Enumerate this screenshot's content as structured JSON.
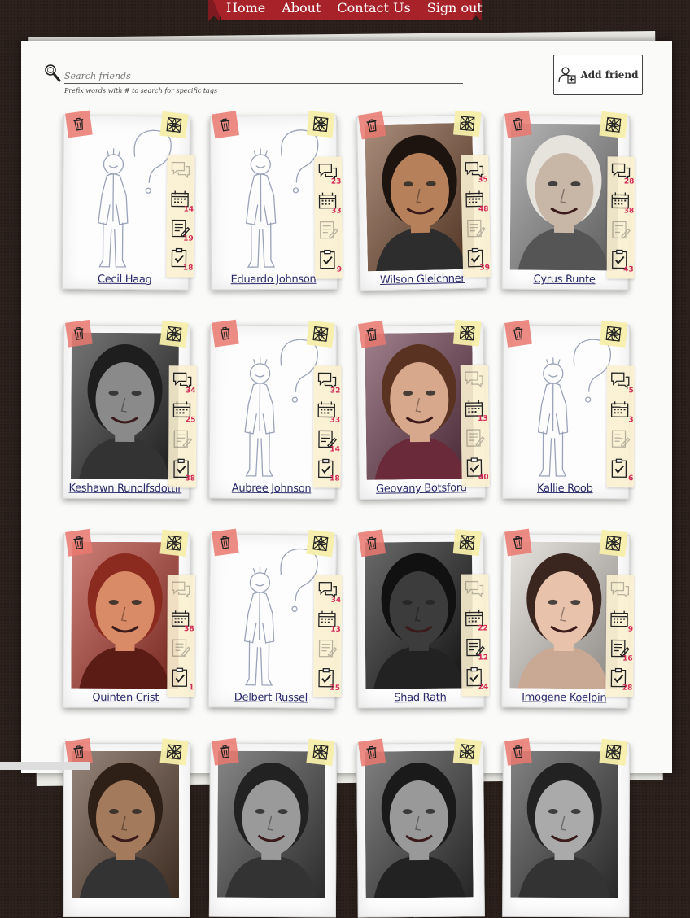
{
  "nav": {
    "home": "Home",
    "about": "About",
    "contact": "Contact Us",
    "signout": "Sign out"
  },
  "search": {
    "placeholder": "Search friends",
    "hint": "Prefix words with # to search for specific tags"
  },
  "add_friend_label": "Add friend",
  "colors": {
    "ribbon": "#a8222a",
    "count": "#d12a58",
    "name": "#2a2a6a",
    "trash": "#ea786e",
    "tag": "#f6eeaa"
  },
  "friends": [
    {
      "name": "Cecil Haag",
      "photo": "placeholder",
      "messages": "",
      "events": "14",
      "notes": "19",
      "tasks": "18"
    },
    {
      "name": "Eduardo Johnson",
      "photo": "placeholder",
      "messages": "23",
      "events": "33",
      "notes": "",
      "tasks": "9"
    },
    {
      "name": "Wilson Gleichner",
      "photo": "photo",
      "messages": "35",
      "events": "48",
      "notes": "",
      "tasks": "39"
    },
    {
      "name": "Cyrus Runte",
      "photo": "photo",
      "messages": "28",
      "events": "38",
      "notes": "",
      "tasks": "43"
    },
    {
      "name": "Keshawn Runolfsdottir",
      "photo": "photo",
      "messages": "34",
      "events": "25",
      "notes": "",
      "tasks": "38"
    },
    {
      "name": "Aubree Johnson",
      "photo": "placeholder",
      "messages": "32",
      "events": "33",
      "notes": "14",
      "tasks": "18"
    },
    {
      "name": "Geovany Botsford",
      "photo": "photo",
      "messages": "",
      "events": "13",
      "notes": "",
      "tasks": "40"
    },
    {
      "name": "Kallie Roob",
      "photo": "placeholder",
      "messages": "5",
      "events": "3",
      "notes": "",
      "tasks": "6"
    },
    {
      "name": "Quinten Crist",
      "photo": "photo",
      "messages": "",
      "events": "38",
      "notes": "",
      "tasks": "1"
    },
    {
      "name": "Delbert Russel",
      "photo": "placeholder",
      "messages": "34",
      "events": "13",
      "notes": "",
      "tasks": "25"
    },
    {
      "name": "Shad Rath",
      "photo": "photo",
      "messages": "",
      "events": "22",
      "notes": "12",
      "tasks": "24"
    },
    {
      "name": "Imogene Koelpin",
      "photo": "photo",
      "messages": "",
      "events": "9",
      "notes": "16",
      "tasks": "28"
    },
    {
      "name": "",
      "photo": "photo",
      "messages": "",
      "events": "",
      "notes": "",
      "tasks": ""
    },
    {
      "name": "",
      "photo": "photo",
      "messages": "",
      "events": "",
      "notes": "",
      "tasks": ""
    },
    {
      "name": "",
      "photo": "photo",
      "messages": "",
      "events": "",
      "notes": "",
      "tasks": ""
    },
    {
      "name": "",
      "photo": "photo",
      "messages": "",
      "events": "",
      "notes": "",
      "tasks": ""
    }
  ]
}
